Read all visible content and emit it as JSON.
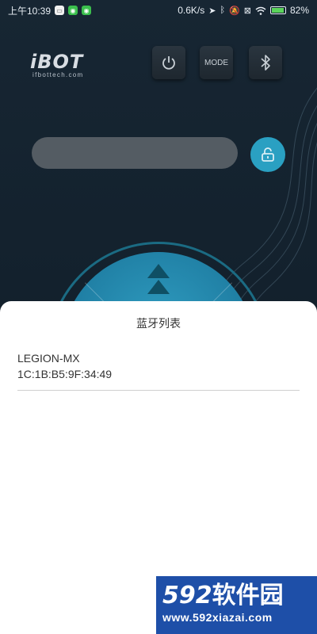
{
  "status_bar": {
    "time": "上午10:39",
    "network_speed": "0.6K/s",
    "battery_percent": "82%",
    "battery_level": 0.82,
    "battery_color": "#5bd45b",
    "icons": [
      "app-icon-green",
      "app-icon-green",
      "app-icon-green",
      "location-icon",
      "bluetooth-icon",
      "mute-icon",
      "sim-icon",
      "wifi-icon",
      "battery-icon"
    ]
  },
  "header": {
    "logo_text": "iBOT",
    "logo_subtext": "ifbottech.com",
    "power_icon": "power-icon",
    "mode_label": "MODE",
    "bluetooth_icon": "bluetooth-icon"
  },
  "controls": {
    "unlock_icon": "unlock-icon",
    "accent_color": "#2aa0c2"
  },
  "bluetooth_sheet": {
    "title": "蓝牙列表",
    "devices": [
      {
        "name": "LEGION-MX",
        "mac": "1C:1B:B5:9F:34:49"
      }
    ]
  },
  "watermark": {
    "number": "592",
    "text": "软件园",
    "url": "www.592xiazai.com"
  }
}
